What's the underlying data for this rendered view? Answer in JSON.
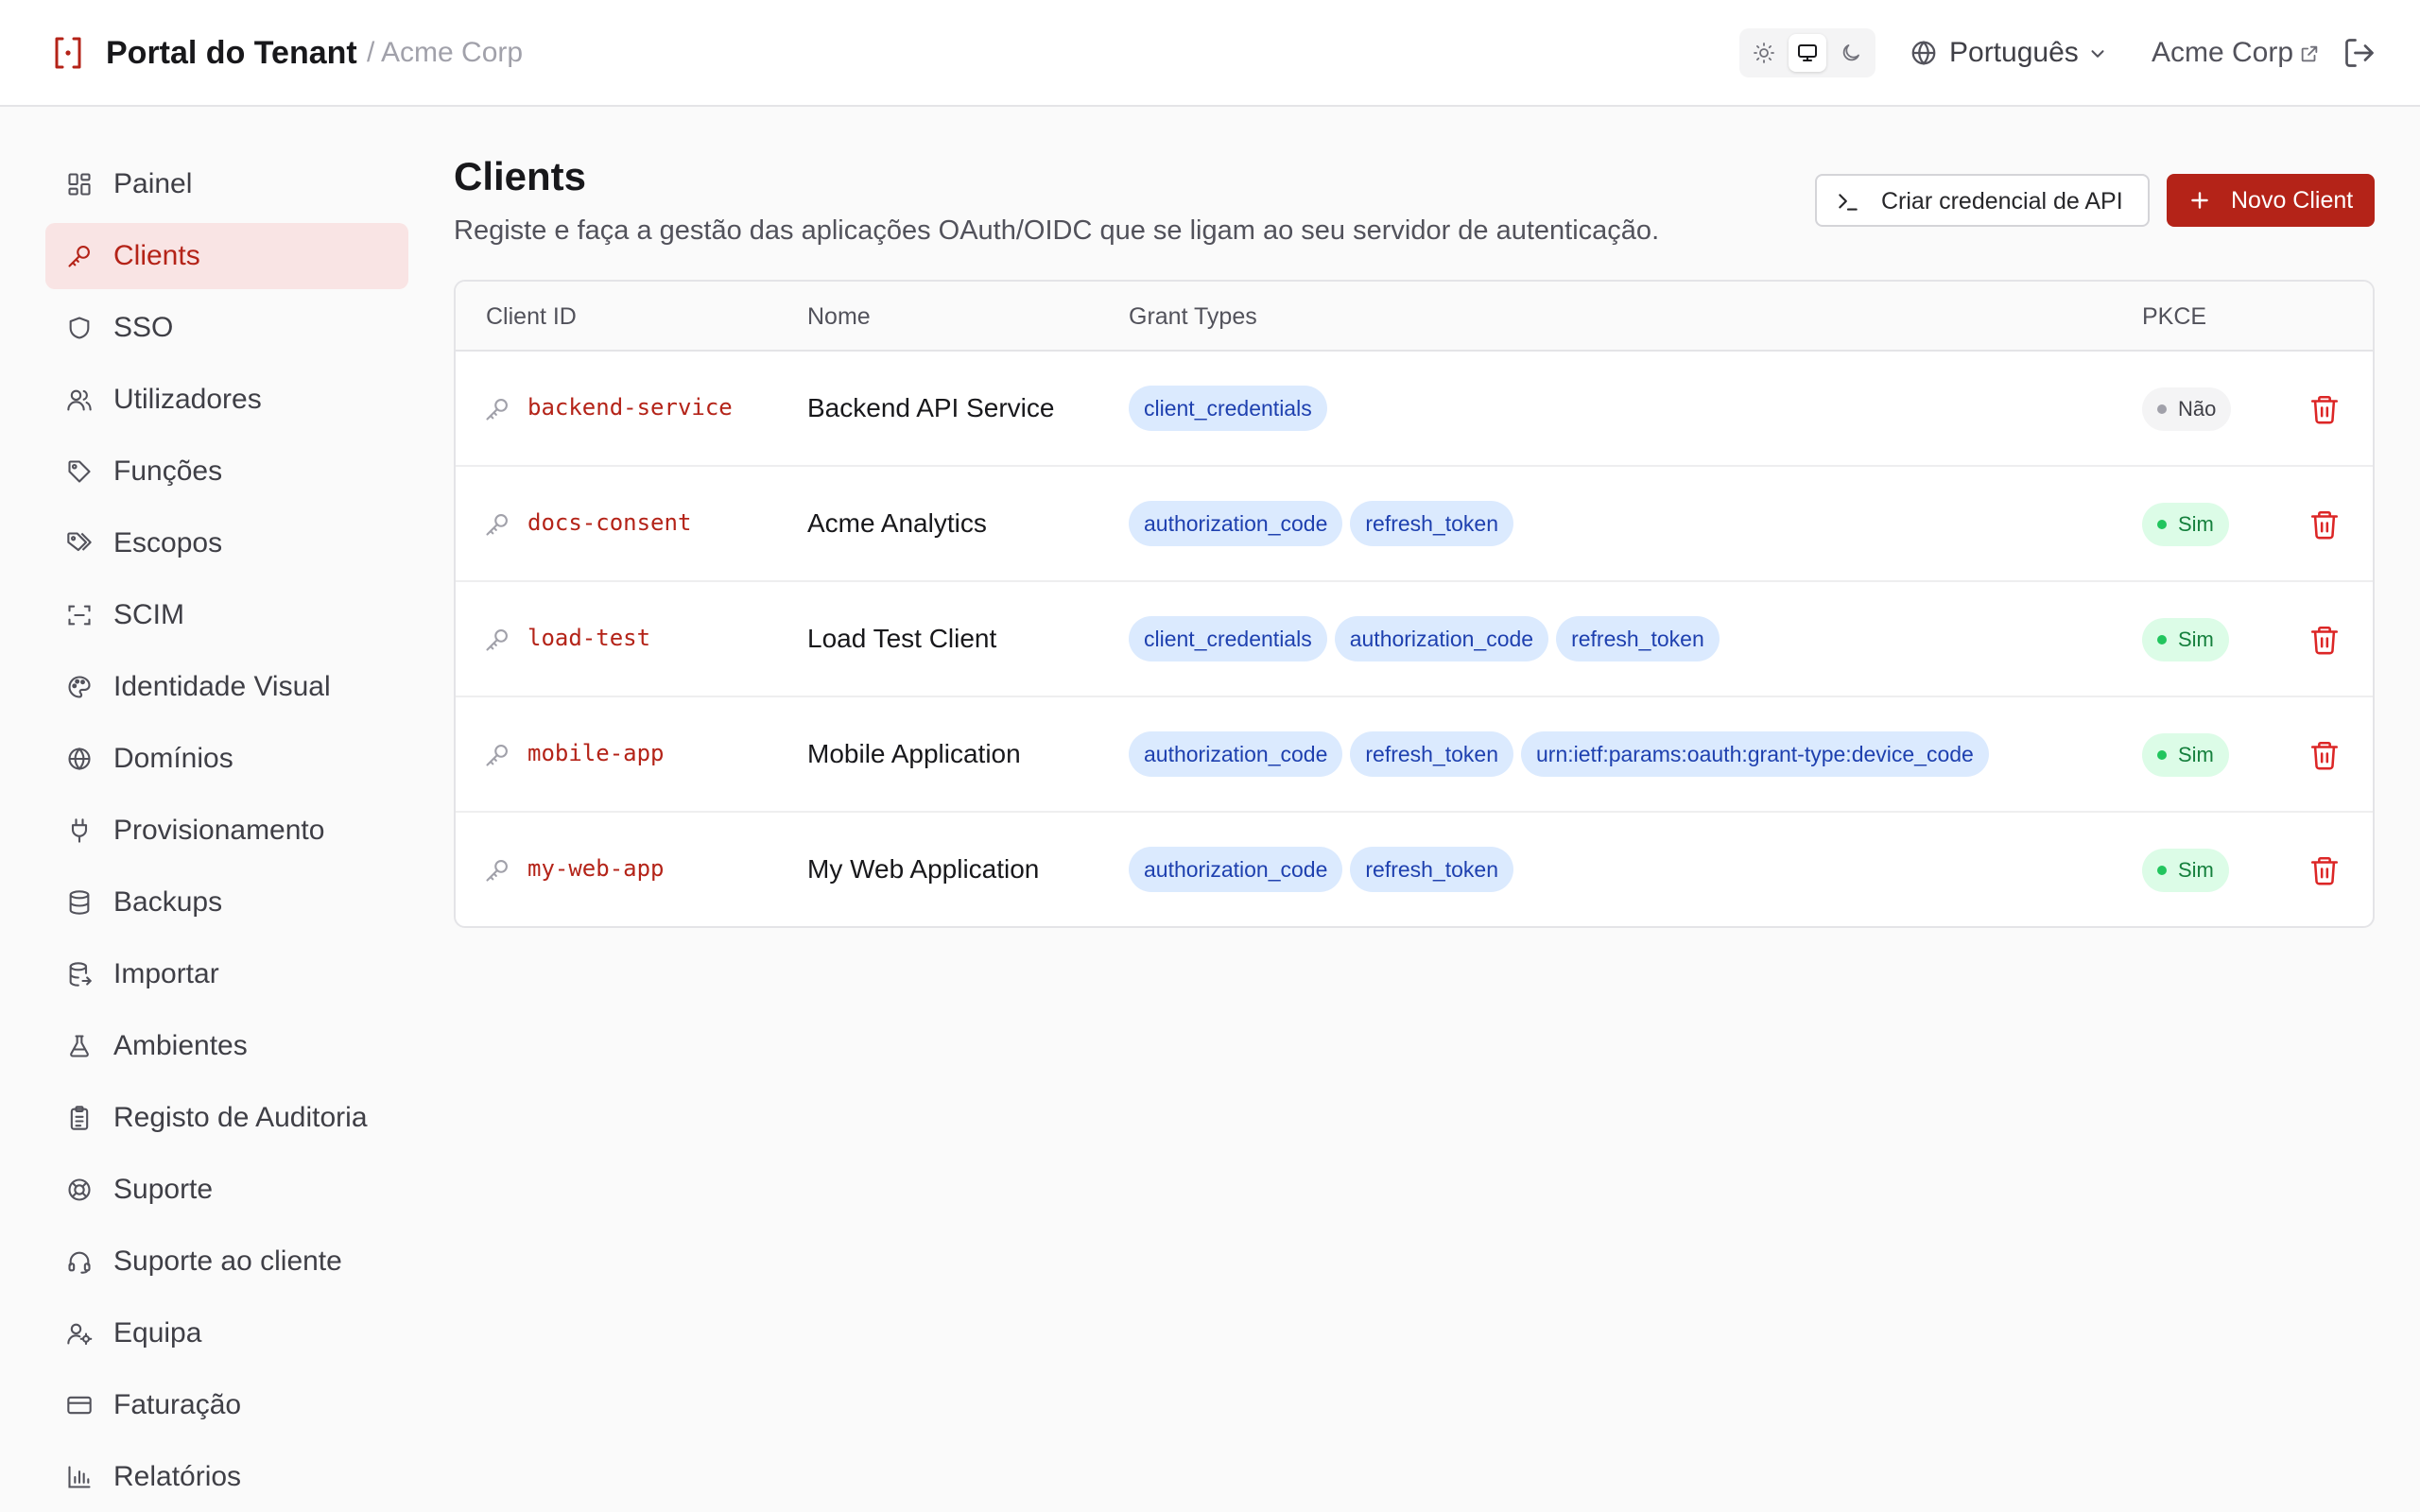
{
  "header": {
    "brand_name": "Portal do Tenant",
    "breadcrumb": "/ Acme Corp",
    "language": "Português",
    "org_name": "Acme Corp",
    "theme_modes": [
      "sun-icon",
      "monitor-icon",
      "moon-icon"
    ],
    "active_theme": "monitor-icon"
  },
  "colors": {
    "accent": "#b42318",
    "accent_soft": "#f9e4e4",
    "grant_bg": "#dbeafe",
    "grant_text": "#1e40af",
    "pkce_yes": "#15803d",
    "pkce_no": "#3f3f46"
  },
  "sidebar": {
    "items": [
      {
        "label": "Painel",
        "icon": "dashboard-icon",
        "active": false
      },
      {
        "label": "Clients",
        "icon": "key-icon",
        "active": true
      },
      {
        "label": "SSO",
        "icon": "shield-icon",
        "active": false
      },
      {
        "label": "Utilizadores",
        "icon": "users-icon",
        "active": false
      },
      {
        "label": "Funções",
        "icon": "tag-icon",
        "active": false
      },
      {
        "label": "Escopos",
        "icon": "tags-icon",
        "active": false
      },
      {
        "label": "SCIM",
        "icon": "scan-icon",
        "active": false
      },
      {
        "label": "Identidade Visual",
        "icon": "palette-icon",
        "active": false
      },
      {
        "label": "Domínios",
        "icon": "globe-icon",
        "active": false
      },
      {
        "label": "Provisionamento",
        "icon": "plug-icon",
        "active": false
      },
      {
        "label": "Backups",
        "icon": "database-icon",
        "active": false
      },
      {
        "label": "Importar",
        "icon": "database-import-icon",
        "active": false
      },
      {
        "label": "Ambientes",
        "icon": "flask-icon",
        "active": false
      },
      {
        "label": "Registo de Auditoria",
        "icon": "clipboard-icon",
        "active": false
      },
      {
        "label": "Suporte",
        "icon": "lifebuoy-icon",
        "active": false
      },
      {
        "label": "Suporte ao cliente",
        "icon": "headset-icon",
        "active": false
      },
      {
        "label": "Equipa",
        "icon": "user-cog-icon",
        "active": false
      },
      {
        "label": "Faturação",
        "icon": "credit-card-icon",
        "active": false
      },
      {
        "label": "Relatórios",
        "icon": "bar-chart-icon",
        "active": false
      }
    ]
  },
  "main": {
    "title": "Clients",
    "subtitle": "Registe e faça a gestão das aplicações OAuth/OIDC que se ligam ao seu servidor de autenticação.",
    "create_api_credential": "Criar credencial de API",
    "new_client": "Novo Client",
    "table": {
      "columns": [
        "Client ID",
        "Nome",
        "Grant Types",
        "PKCE"
      ],
      "rows": [
        {
          "client_id": "backend-service",
          "name": "Backend API Service",
          "grants": [
            "client_credentials"
          ],
          "pkce": "Não",
          "pkce_enabled": false
        },
        {
          "client_id": "docs-consent",
          "name": "Acme Analytics",
          "grants": [
            "authorization_code",
            "refresh_token"
          ],
          "pkce": "Sim",
          "pkce_enabled": true
        },
        {
          "client_id": "load-test",
          "name": "Load Test Client",
          "grants": [
            "client_credentials",
            "authorization_code",
            "refresh_token"
          ],
          "pkce": "Sim",
          "pkce_enabled": true
        },
        {
          "client_id": "mobile-app",
          "name": "Mobile Application",
          "grants": [
            "authorization_code",
            "refresh_token",
            "urn:ietf:params:oauth:grant-type:device_code"
          ],
          "pkce": "Sim",
          "pkce_enabled": true
        },
        {
          "client_id": "my-web-app",
          "name": "My Web Application",
          "grants": [
            "authorization_code",
            "refresh_token"
          ],
          "pkce": "Sim",
          "pkce_enabled": true
        }
      ]
    }
  }
}
